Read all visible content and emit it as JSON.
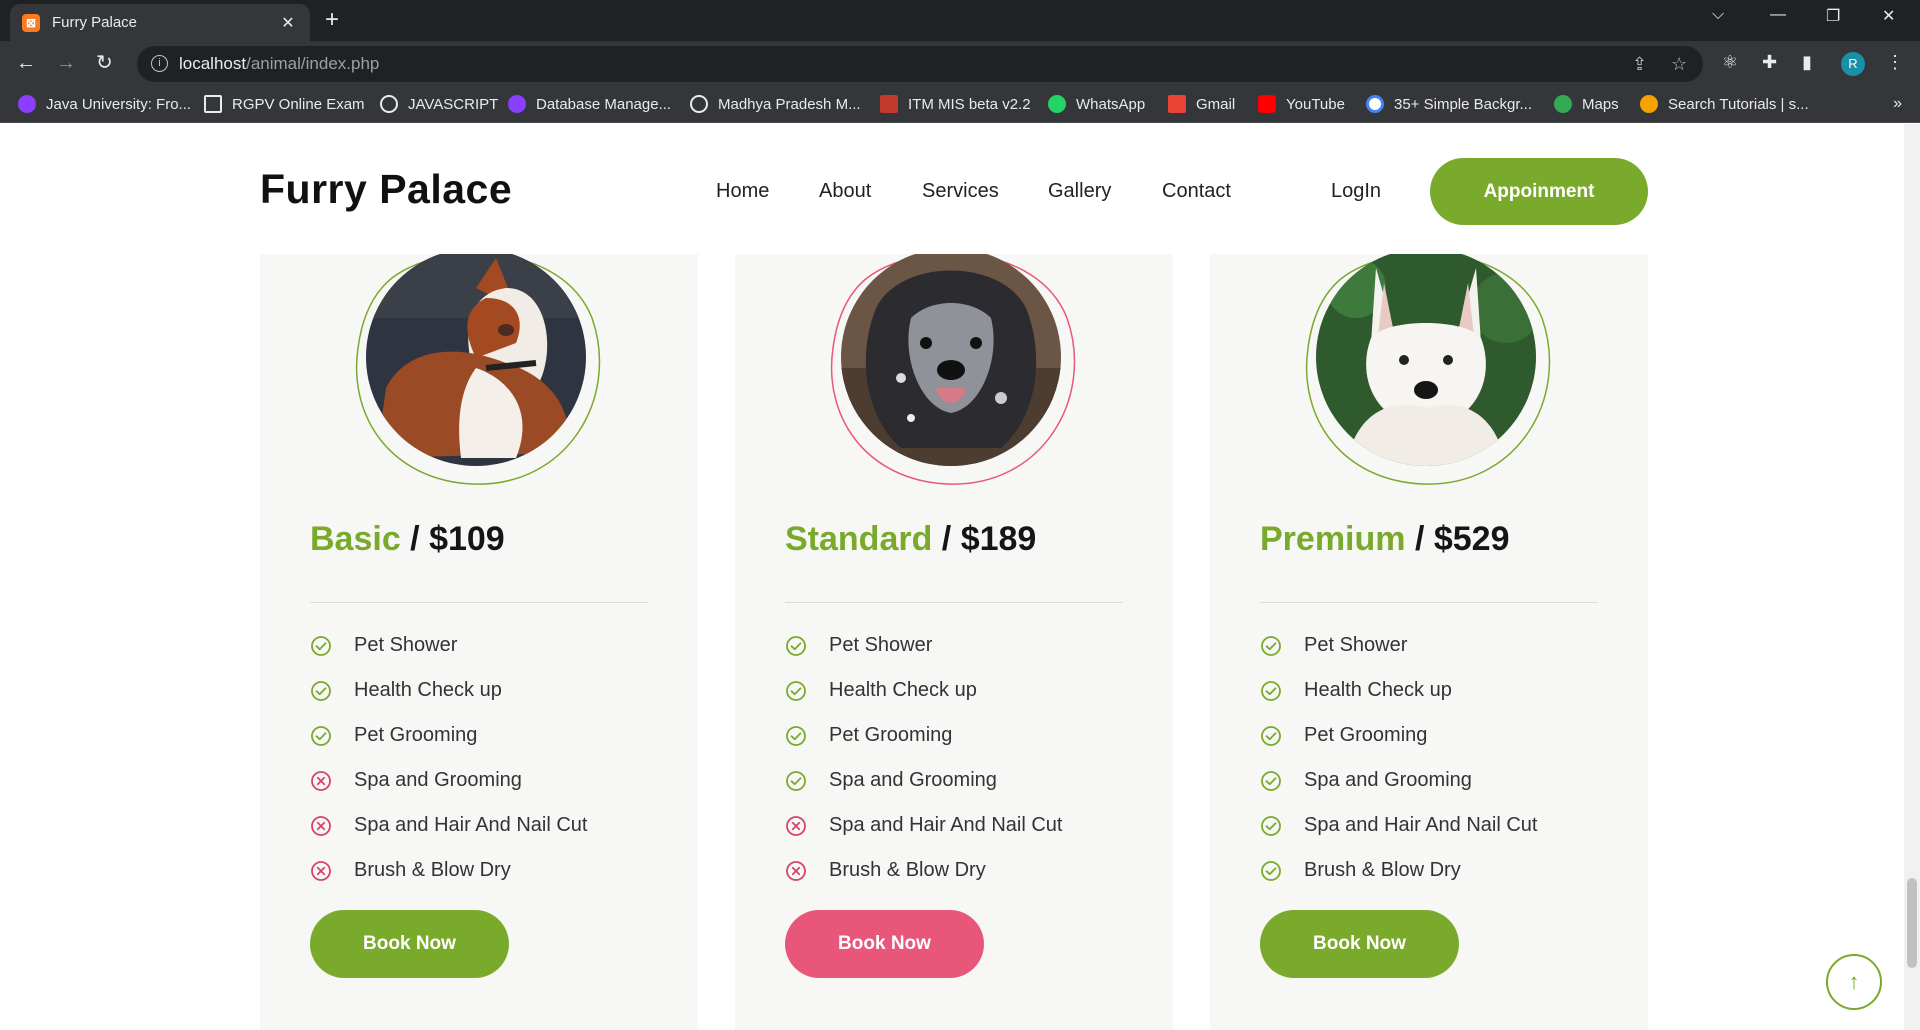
{
  "browser": {
    "tab_title": "Furry Palace",
    "tab_favicon": "xampp-icon",
    "url_host": "localhost",
    "url_path": "/animal/index.php",
    "profile_initial": "R",
    "bookmarks": [
      {
        "label": "Java University: Fro...",
        "icon": "purple-shield-icon",
        "color": "#8a3ffc"
      },
      {
        "label": "RGPV Online Exam",
        "icon": "monitor-icon",
        "color": "#e8eaed"
      },
      {
        "label": "JAVASCRIPT",
        "icon": "globe-icon",
        "color": "#e8eaed"
      },
      {
        "label": "Database Manage...",
        "icon": "purple-shield-icon",
        "color": "#8a3ffc"
      },
      {
        "label": "Madhya Pradesh M...",
        "icon": "globe-icon",
        "color": "#e8eaed"
      },
      {
        "label": "ITM MIS beta v2.2",
        "icon": "itm-icon",
        "color": "#c0392b"
      },
      {
        "label": "WhatsApp",
        "icon": "whatsapp-icon",
        "color": "#25d366"
      },
      {
        "label": "Gmail",
        "icon": "gmail-icon",
        "color": "#ea4335"
      },
      {
        "label": "YouTube",
        "icon": "youtube-icon",
        "color": "#ff0000"
      },
      {
        "label": "35+ Simple Backgr...",
        "icon": "google-icon",
        "color": "#4285f4"
      },
      {
        "label": "Maps",
        "icon": "maps-icon",
        "color": "#34a853"
      },
      {
        "label": "Search Tutorials | s...",
        "icon": "tutorials-icon",
        "color": "#f4a300"
      }
    ],
    "more_bookmarks": "»"
  },
  "header": {
    "brand": "Furry Palace",
    "nav": [
      "Home",
      "About",
      "Services",
      "Gallery",
      "Contact",
      "LogIn"
    ],
    "cta": "Appoinment"
  },
  "plans": [
    {
      "name": "Basic",
      "separator": " / ",
      "price": "$109",
      "ring_color": "#7aaa2b",
      "photo": "brown-white-dog",
      "features": [
        {
          "label": "Pet Shower",
          "included": true
        },
        {
          "label": "Health Check up",
          "included": true
        },
        {
          "label": "Pet Grooming",
          "included": true
        },
        {
          "label": "Spa and Grooming",
          "included": false
        },
        {
          "label": "Spa and Hair And Nail Cut",
          "included": false
        },
        {
          "label": "Brush & Blow Dry",
          "included": false
        }
      ],
      "button": "Book Now",
      "button_color": "#7aaa2b"
    },
    {
      "name": "Standard",
      "separator": " / ",
      "price": "$189",
      "ring_color": "#e8577a",
      "photo": "merle-dog",
      "features": [
        {
          "label": "Pet Shower",
          "included": true
        },
        {
          "label": "Health Check up",
          "included": true
        },
        {
          "label": "Pet Grooming",
          "included": true
        },
        {
          "label": "Spa and Grooming",
          "included": true
        },
        {
          "label": "Spa and Hair And Nail Cut",
          "included": false
        },
        {
          "label": "Brush & Blow Dry",
          "included": false
        }
      ],
      "button": "Book Now",
      "button_color": "#e8577a"
    },
    {
      "name": "Premium",
      "separator": " / ",
      "price": "$529",
      "ring_color": "#7aaa2b",
      "photo": "white-shepherd-dog",
      "features": [
        {
          "label": "Pet Shower",
          "included": true
        },
        {
          "label": "Health Check up",
          "included": true
        },
        {
          "label": "Pet Grooming",
          "included": true
        },
        {
          "label": "Spa and Grooming",
          "included": true
        },
        {
          "label": "Spa and Hair And Nail Cut",
          "included": true
        },
        {
          "label": "Brush & Blow Dry",
          "included": true
        }
      ],
      "button": "Book Now",
      "button_color": "#7aaa2b"
    }
  ],
  "colors": {
    "accent_green": "#7aaa2b",
    "accent_pink": "#e8577a",
    "check": "#7aaa2b",
    "cross": "#d9436a"
  },
  "back_to_top_icon": "arrow-up-icon"
}
